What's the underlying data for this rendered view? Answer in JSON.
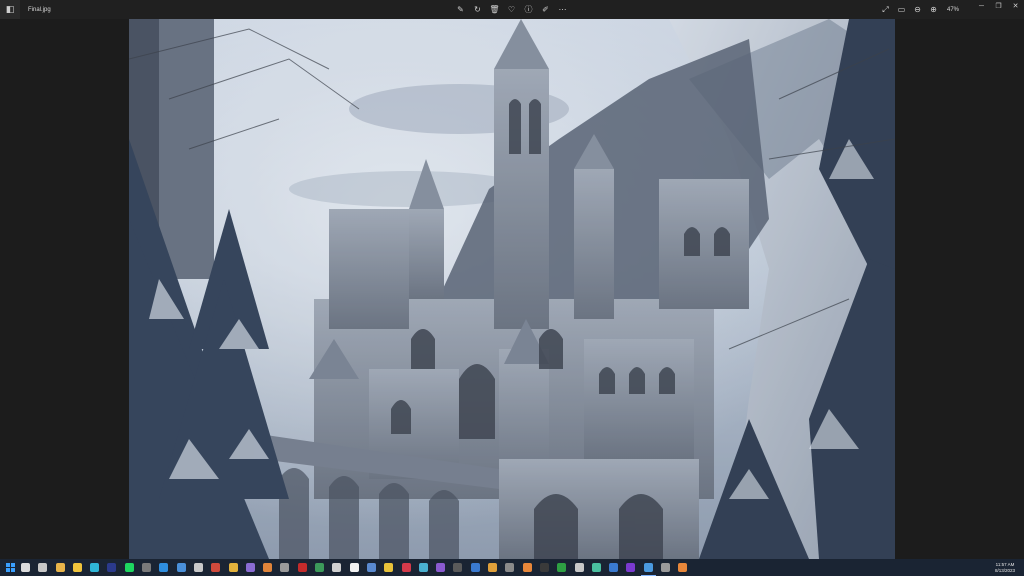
{
  "app": {
    "filename": "Final.jpg",
    "icon": "photos-app-icon"
  },
  "toolbar": {
    "center_buttons": [
      {
        "name": "edit-image-icon",
        "glyph": "✎"
      },
      {
        "name": "rotate-icon",
        "glyph": "↻"
      },
      {
        "name": "delete-icon",
        "glyph": "🗑"
      },
      {
        "name": "favorite-icon",
        "glyph": "♡"
      },
      {
        "name": "info-icon",
        "glyph": "ⓘ"
      },
      {
        "name": "edit-draw-icon",
        "glyph": "✐"
      },
      {
        "name": "more-options-icon",
        "glyph": "⋯"
      }
    ],
    "right_buttons": [
      {
        "name": "fullscreen-icon",
        "glyph": "⤢"
      },
      {
        "name": "fit-window-icon",
        "glyph": "▭"
      },
      {
        "name": "zoom-out-icon",
        "glyph": "⊖"
      },
      {
        "name": "zoom-in-icon",
        "glyph": "⊕"
      }
    ],
    "zoom_level": "47%"
  },
  "window_controls": [
    {
      "name": "minimize-icon",
      "glyph": "─"
    },
    {
      "name": "restore-icon",
      "glyph": "❐"
    },
    {
      "name": "close-icon",
      "glyph": "✕"
    }
  ],
  "taskbar": {
    "items": [
      {
        "name": "search-icon",
        "color": "#dcdcdc"
      },
      {
        "name": "task-view-icon",
        "color": "#c8c8c8"
      },
      {
        "name": "folder-app-icon",
        "color": "#e8b44a"
      },
      {
        "name": "file-explorer-icon",
        "color": "#f0c43c"
      },
      {
        "name": "edge-icon",
        "color": "#2fb6d8"
      },
      {
        "name": "pycharm-icon",
        "color": "#2b3a8c"
      },
      {
        "name": "spotify-icon",
        "color": "#1ed760"
      },
      {
        "name": "app-icon-1",
        "color": "#7a7a7a"
      },
      {
        "name": "app-icon-2",
        "color": "#2f8fe0"
      },
      {
        "name": "app-icon-3",
        "color": "#4a90d9"
      },
      {
        "name": "app-icon-4",
        "color": "#c8c8c8"
      },
      {
        "name": "app-icon-5",
        "color": "#d04a3c"
      },
      {
        "name": "chrome-icon",
        "color": "#e3b23c"
      },
      {
        "name": "app-icon-6",
        "color": "#8a6cd4"
      },
      {
        "name": "app-icon-7",
        "color": "#e0843a"
      },
      {
        "name": "app-icon-8",
        "color": "#9a9a9a"
      },
      {
        "name": "app-icon-9",
        "color": "#c42b2b"
      },
      {
        "name": "app-icon-10",
        "color": "#3c9a5a"
      },
      {
        "name": "app-icon-11",
        "color": "#d0d0d0"
      },
      {
        "name": "app-icon-12",
        "color": "#f2f2f2"
      },
      {
        "name": "app-icon-13",
        "color": "#5a8ad0"
      },
      {
        "name": "app-icon-14",
        "color": "#e8c23a"
      },
      {
        "name": "app-icon-15",
        "color": "#d43a4a"
      },
      {
        "name": "app-icon-16",
        "color": "#4ab0d0"
      },
      {
        "name": "app-icon-17",
        "color": "#8a5ad0"
      },
      {
        "name": "app-icon-18",
        "color": "#5a5a5a"
      },
      {
        "name": "app-icon-19",
        "color": "#3a7ad0"
      },
      {
        "name": "app-icon-20",
        "color": "#e0a03a"
      },
      {
        "name": "app-icon-21",
        "color": "#8a8a8a"
      },
      {
        "name": "blender-icon",
        "color": "#e8873a"
      },
      {
        "name": "app-icon-22",
        "color": "#3a3a3a"
      },
      {
        "name": "xbox-icon",
        "color": "#2ea043"
      },
      {
        "name": "app-icon-23",
        "color": "#c8c8c8"
      },
      {
        "name": "app-icon-24",
        "color": "#4ac0a0"
      },
      {
        "name": "app-icon-25",
        "color": "#3a7ad0"
      },
      {
        "name": "app-icon-26",
        "color": "#7a3ad0"
      },
      {
        "name": "photos-taskbar-icon",
        "color": "#4a9ae0",
        "active": true
      },
      {
        "name": "app-icon-27",
        "color": "#9a9a9a"
      },
      {
        "name": "blender-icon-2",
        "color": "#e8873a"
      }
    ]
  },
  "clock": {
    "time": "11:57 AM",
    "date": "8/13/2023"
  }
}
